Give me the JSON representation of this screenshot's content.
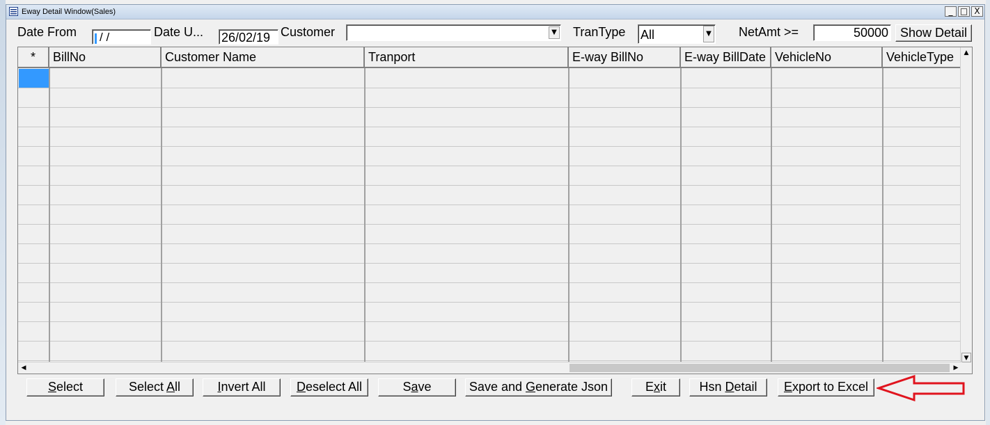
{
  "window": {
    "title": "Eway Detail Window(Sales)",
    "min": "_",
    "max": "□",
    "close": "X"
  },
  "filters": {
    "date_from_label": "Date From",
    "date_from_value": "/  /",
    "date_upto_label": "Date U...",
    "date_upto_value": "26/02/19",
    "customer_label": "Customer",
    "customer_value": "",
    "trantype_label": "TranType",
    "trantype_value": "All",
    "netamt_label": "NetAmt >=",
    "netamt_value": "50000",
    "show_detail": "Show Detail"
  },
  "grid": {
    "columns": [
      "*",
      "BillNo",
      "Customer Name",
      "Tranport",
      "E-way BillNo",
      "E-way BillDate",
      "VehicleNo",
      "VehicleType"
    ]
  },
  "buttons": {
    "select": "Select",
    "select_all": "Select All",
    "invert_all": "Invert All",
    "deselect_all": "Deselect All",
    "save": "Save",
    "save_generate": "Save and Generate Json",
    "exit": "Exit",
    "hsn_detail": "Hsn Detail",
    "export_excel": "Export to Excel"
  },
  "annotation": {
    "arrow_color": "#e0141e",
    "arrow_target": "Export to Excel"
  }
}
